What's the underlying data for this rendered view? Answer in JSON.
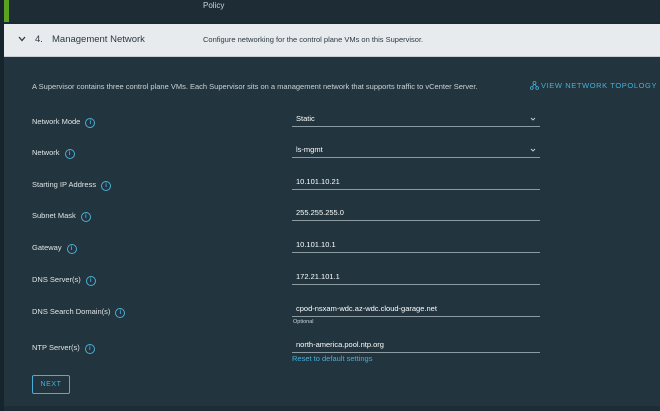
{
  "previous_step": {
    "text": "Policy"
  },
  "step": {
    "number": "4.",
    "title": "Management Network",
    "description": "Configure networking for the control plane VMs on this Supervisor."
  },
  "intro_text": "A Supervisor contains three control plane VMs. Each Supervisor sits on a management network that supports traffic to vCenter Server.",
  "topology_link": "VIEW NETWORK TOPOLOGY",
  "form": {
    "network_mode": {
      "label": "Network Mode",
      "value": "Static"
    },
    "network": {
      "label": "Network",
      "value": "ls-mgmt"
    },
    "starting_ip": {
      "label": "Starting IP Address",
      "value": "10.101.10.21"
    },
    "subnet_mask": {
      "label": "Subnet Mask",
      "value": "255.255.255.0"
    },
    "gateway": {
      "label": "Gateway",
      "value": "10.101.10.1"
    },
    "dns_servers": {
      "label": "DNS Server(s)",
      "value": "172.21.101.1"
    },
    "dns_search": {
      "label": "DNS Search Domain(s)",
      "value": "cpod-nsxam-wdc.az-wdc.cloud-garage.net",
      "hint": "Optional"
    },
    "ntp_servers": {
      "label": "NTP Server(s)",
      "value": "north-america.pool.ntp.org"
    }
  },
  "reset_link": "Reset to default settings",
  "next_button": "NEXT",
  "colors": {
    "accent": "#49afd9",
    "panel": "#22343d",
    "header": "#e8ebed",
    "status": "#5aa220"
  },
  "icons": [
    "chevron-down-icon",
    "info-icon",
    "network-topology-icon",
    "caret-down-icon"
  ]
}
